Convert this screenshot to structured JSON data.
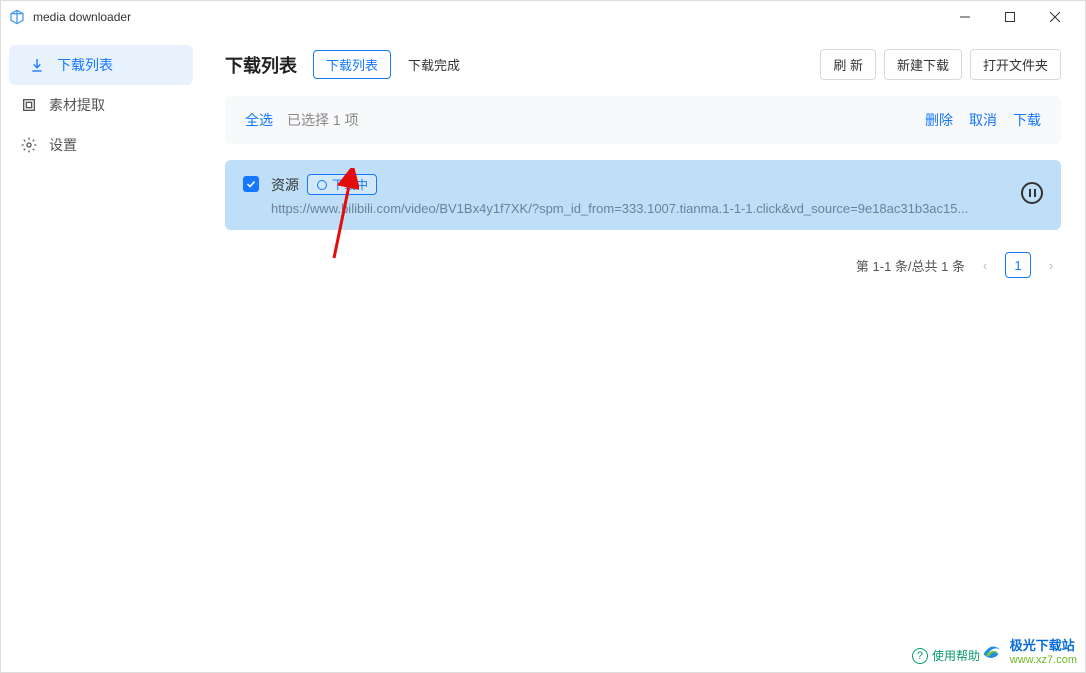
{
  "app": {
    "title": "media downloader"
  },
  "sidebar": {
    "items": [
      {
        "label": "下载列表",
        "icon": "download"
      },
      {
        "label": "素材提取",
        "icon": "extract"
      },
      {
        "label": "设置",
        "icon": "gear"
      }
    ]
  },
  "header": {
    "page_title": "下载列表",
    "tabs": [
      {
        "label": "下载列表"
      },
      {
        "label": "下载完成"
      }
    ],
    "actions": {
      "refresh": "刷 新",
      "new_download": "新建下载",
      "open_folder": "打开文件夹"
    }
  },
  "selection_bar": {
    "select_all": "全选",
    "info": "已选择 1 项",
    "delete": "删除",
    "cancel": "取消",
    "download": "下载"
  },
  "item": {
    "name": "资源",
    "status": "下载中",
    "url": "https://www.bilibili.com/video/BV1Bx4y1f7XK/?spm_id_from=333.1007.tianma.1-1-1.click&vd_source=9e18ac31b3ac15..."
  },
  "pagination": {
    "range_text": "第 1-1 条/总共 1 条",
    "current": "1"
  },
  "watermark": {
    "brand": "极光下载站",
    "sub": "www.xz7.com",
    "help": "使用帮助"
  }
}
